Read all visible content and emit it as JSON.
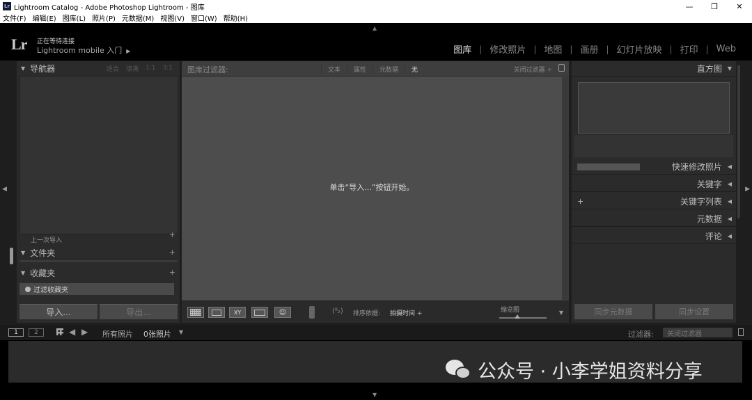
{
  "window": {
    "title": "Lightroom Catalog - Adobe Photoshop Lightroom - 图库",
    "icon": "Lr",
    "minimize": "—",
    "restore": "❐",
    "close": "✕"
  },
  "menu": [
    "文件(F)",
    "编辑(E)",
    "图库(L)",
    "照片(P)",
    "元数据(M)",
    "视图(V)",
    "窗口(W)",
    "帮助(H)"
  ],
  "identity": {
    "logo": "Lr",
    "status_line1": "正在等待连接",
    "status_line2": "Lightroom mobile 入门"
  },
  "modules": [
    "图库",
    "修改照片",
    "地图",
    "画册",
    "幻灯片放映",
    "打印",
    "Web"
  ],
  "left_panel": {
    "navigator": "导航器",
    "nav_options": [
      "适合",
      "填满",
      "1:1",
      "3:1"
    ],
    "prev_import": "上一次导入",
    "folders": "文件夹",
    "collections": "收藏夹",
    "filter_collections": "过滤收藏夹",
    "import_btn": "导入...",
    "export_btn": "导出..."
  },
  "center": {
    "filter_title": "图库过滤器:",
    "filter_options": [
      "文本",
      "属性",
      "元数据",
      "无"
    ],
    "filter_close": "关闭过滤器 ÷",
    "grid_message": "单击“导入...”按钮开始。",
    "sort_label": "排序依据:",
    "sort_value": "拍摄时间 ÷",
    "thumb_label": "缩览图",
    "face_view": "☺"
  },
  "right_panel": {
    "histogram": "直方图",
    "quick_develop": "快速修改照片",
    "keywording": "关键字",
    "keyword_list": "关键字列表",
    "metadata": "元数据",
    "comments": "评论",
    "sync_metadata": "同步元数据",
    "sync_settings": "同步设置"
  },
  "filmstrip_bar": {
    "page1": "1",
    "page2": "2",
    "all_photos": "所有照片",
    "photo_count": "0张照片",
    "filter_label": "过滤器:",
    "filter_value": "关闭过滤器"
  },
  "watermark": "公众号 · 小李学姐资料分享"
}
